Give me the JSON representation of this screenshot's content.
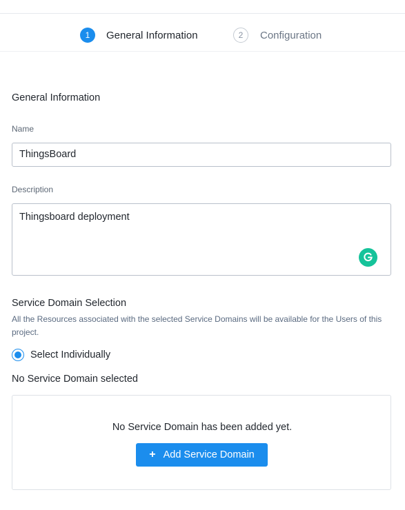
{
  "stepper": {
    "steps": [
      {
        "number": "1",
        "label": "General Information",
        "state": "active"
      },
      {
        "number": "2",
        "label": "Configuration",
        "state": "inactive"
      }
    ]
  },
  "form": {
    "section_title": "General Information",
    "name_label": "Name",
    "name_value": "ThingsBoard",
    "description_label": "Description",
    "description_value": "Thingsboard deployment"
  },
  "service_domain": {
    "title": "Service Domain Selection",
    "description": "All the Resources associated with the selected Service Domains will be available for the Users of this project.",
    "radio_label": "Select Individually",
    "none_selected": "No Service Domain selected",
    "empty_message": "No Service Domain has been added yet.",
    "add_button": "Add Service Domain",
    "add_icon": "plus-icon"
  },
  "colors": {
    "accent": "#1b8ded",
    "grammarly": "#15c39a"
  }
}
